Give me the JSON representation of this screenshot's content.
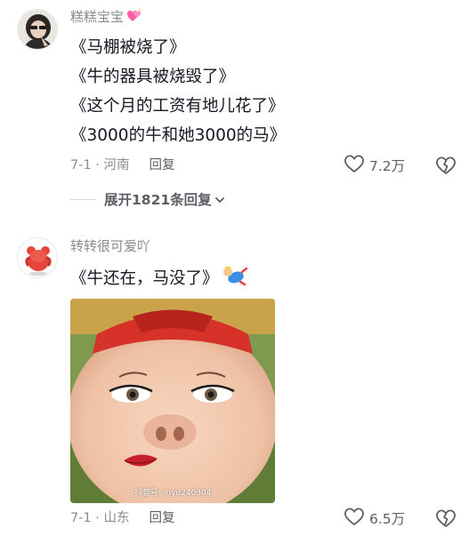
{
  "comments": [
    {
      "username": "糕糕宝宝",
      "badge_icon": "sparkling-heart-icon",
      "lines": [
        "《马棚被烧了》",
        "《牛的器具被烧毁了》",
        "《这个月的工资有地儿花了》",
        "《3000的牛和她3000的马》"
      ],
      "date": "7-1",
      "location": "河南",
      "reply_label": "回复",
      "like_count": "7.2万",
      "expand_label": "展开1821条回复"
    },
    {
      "username": "转转很可爱吖",
      "text": "《牛还在，马没了》",
      "sticker_icon": "falling-figure-sticker",
      "image_watermark": "抖音号: luyu240304",
      "date": "7-1",
      "location": "山东",
      "reply_label": "回复",
      "like_count": "6.5万"
    }
  ],
  "colors": {
    "text_primary": "#161823",
    "text_secondary": "#8a8b91",
    "heart_pink": "#ff5fa2"
  }
}
